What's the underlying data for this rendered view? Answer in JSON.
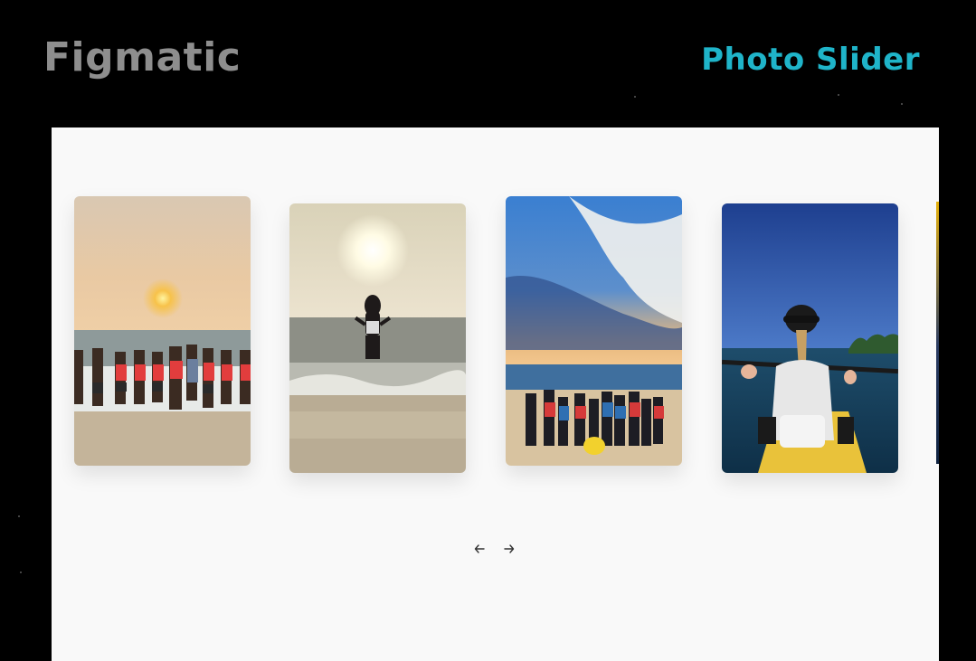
{
  "header": {
    "brand": "Figmatic",
    "title": "Photo Slider"
  },
  "slider": {
    "slides": [
      {
        "id": "group-sunset-beach"
      },
      {
        "id": "woman-walking-into-sea"
      },
      {
        "id": "group-beach-blue-sky"
      },
      {
        "id": "woman-in-kayak"
      }
    ],
    "controls": {
      "prev_icon": "arrow-left-icon",
      "next_icon": "arrow-right-icon"
    }
  },
  "colors": {
    "background": "#000000",
    "panel": "#f9f9f9",
    "brand": "#8e8e8e",
    "accent": "#1fb4c9"
  }
}
